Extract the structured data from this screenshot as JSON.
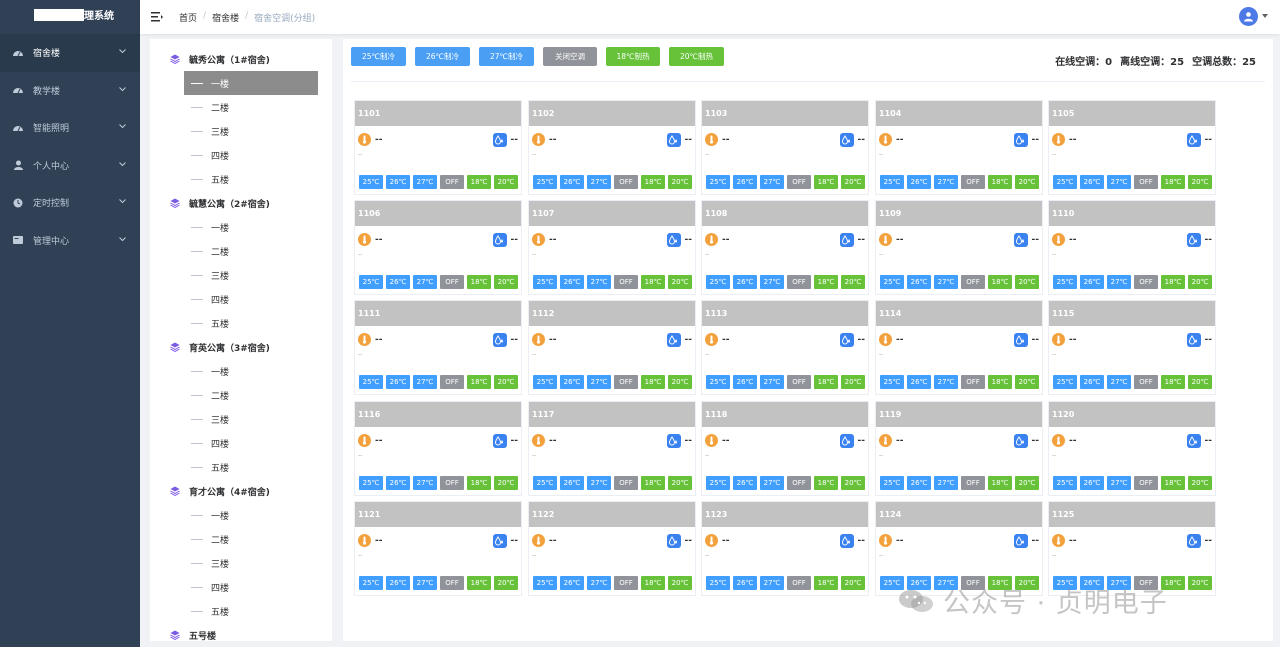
{
  "app": {
    "title": "理系统"
  },
  "sidebar": {
    "items": [
      {
        "label": "宿舍楼",
        "icon": "dashboard-icon"
      },
      {
        "label": "教学楼",
        "icon": "dashboard-icon"
      },
      {
        "label": "智能照明",
        "icon": "dashboard-icon"
      },
      {
        "label": "个人中心",
        "icon": "user-icon"
      },
      {
        "label": "定时控制",
        "icon": "clock-icon"
      },
      {
        "label": "管理中心",
        "icon": "card-icon"
      }
    ]
  },
  "breadcrumb": [
    "首页",
    "宿舍楼",
    "宿舍空调(分组)"
  ],
  "tree": {
    "buildings": [
      {
        "name": "毓秀公寓（1#宿舍)",
        "floors": [
          "一楼",
          "二楼",
          "三楼",
          "四楼",
          "五楼"
        ]
      },
      {
        "name": "毓慧公寓（2#宿舍)",
        "floors": [
          "一楼",
          "二楼",
          "三楼",
          "四楼",
          "五楼"
        ]
      },
      {
        "name": "育英公寓（3#宿舍)",
        "floors": [
          "一楼",
          "二楼",
          "三楼",
          "四楼",
          "五楼"
        ]
      },
      {
        "name": "育才公寓（4#宿舍)",
        "floors": [
          "一楼",
          "二楼",
          "三楼",
          "四楼",
          "五楼"
        ]
      },
      {
        "name": "五号楼",
        "floors": []
      }
    ]
  },
  "controls": [
    {
      "label": "25℃制冷",
      "color": "#4a9ff5"
    },
    {
      "label": "26℃制冷",
      "color": "#4a9ff5"
    },
    {
      "label": "27℃制冷",
      "color": "#4a9ff5"
    },
    {
      "label": "关闭空调",
      "color": "#909399"
    },
    {
      "label": "18℃制热",
      "color": "#67c23a"
    },
    {
      "label": "20℃制热",
      "color": "#67c23a"
    }
  ],
  "stats": {
    "online": "在线空调：0",
    "offline": "离线空调：25",
    "total": "空调总数：25"
  },
  "card_buttons": [
    {
      "label": "25℃",
      "color": "#409eff"
    },
    {
      "label": "26℃",
      "color": "#409eff"
    },
    {
      "label": "27℃",
      "color": "#409eff"
    },
    {
      "label": "OFF",
      "color": "#909399"
    },
    {
      "label": "18℃",
      "color": "#67c23a"
    },
    {
      "label": "20℃",
      "color": "#67c23a"
    }
  ],
  "rooms": [
    "1101",
    "1102",
    "1103",
    "1104",
    "1105",
    "1106",
    "1107",
    "1108",
    "1109",
    "1110",
    "1111",
    "1112",
    "1113",
    "1114",
    "1115",
    "1116",
    "1117",
    "1118",
    "1119",
    "1120",
    "1121",
    "1122",
    "1123",
    "1124",
    "1125"
  ],
  "room_values": {
    "temp": "--",
    "humidity": "--",
    "sub": "--"
  },
  "watermark": "公众号 · 贞明电子"
}
